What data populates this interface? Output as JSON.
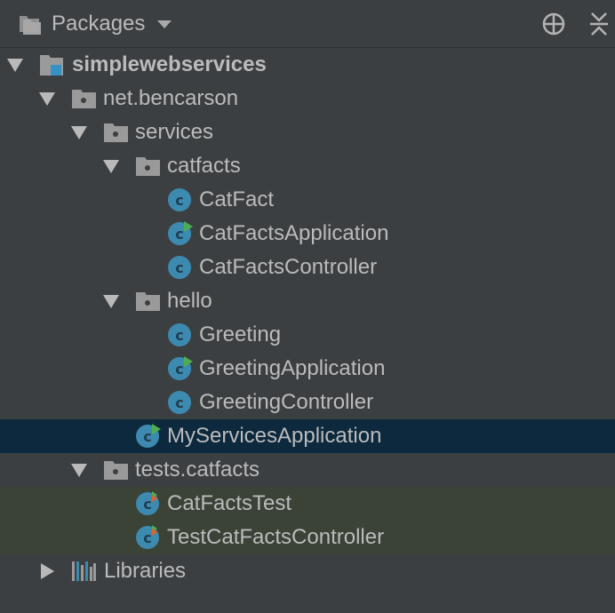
{
  "header": {
    "title": "Packages"
  },
  "tree": {
    "project": "simplewebservices",
    "package_root": "net.bencarson",
    "services": "services",
    "catfacts": "catfacts",
    "cat_fact": "CatFact",
    "cat_facts_application": "CatFactsApplication",
    "cat_facts_controller": "CatFactsController",
    "hello": "hello",
    "greeting": "Greeting",
    "greeting_application": "GreetingApplication",
    "greeting_controller": "GreetingController",
    "my_services_application": "MyServicesApplication",
    "tests_catfacts": "tests.catfacts",
    "cat_facts_test": "CatFactsTest",
    "test_cat_facts_controller": "TestCatFactsController",
    "libraries": "Libraries"
  },
  "colors": {
    "background": "#3c3f41",
    "selected_row": "#0d293e",
    "test_row": "#3a4336",
    "class_icon": "#3d8ab0",
    "run_marker": "#4cae50",
    "test_marker": "#e0602c"
  }
}
